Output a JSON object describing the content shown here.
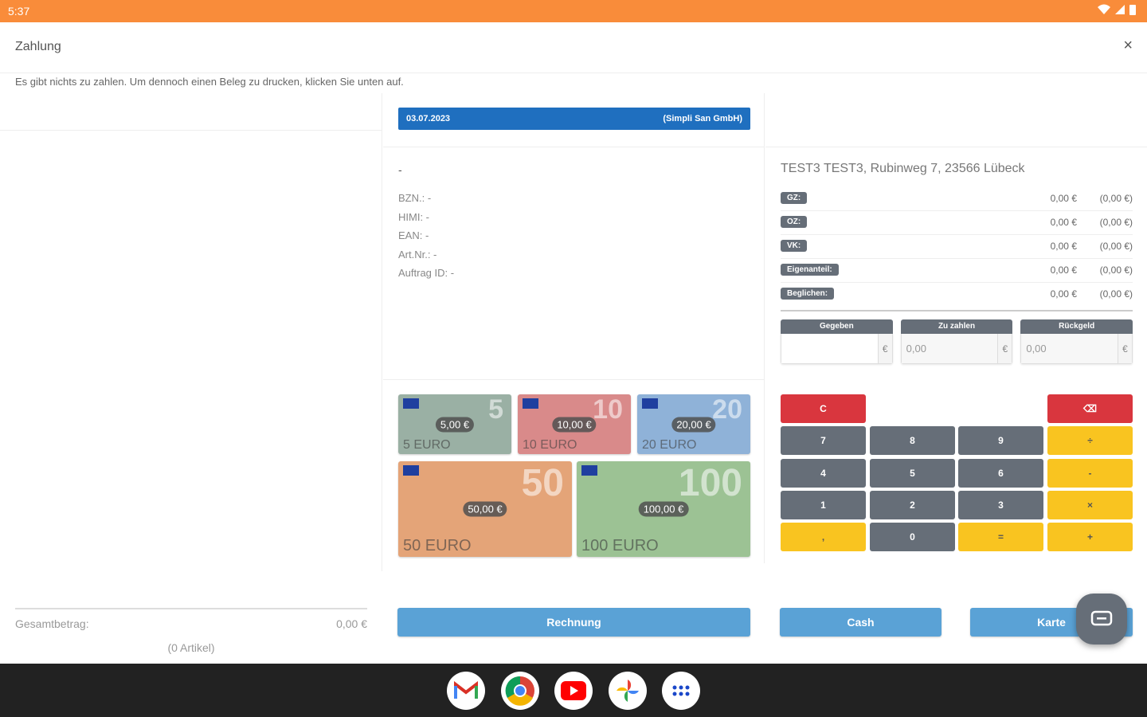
{
  "status_bar": {
    "time": "5:37"
  },
  "dialog": {
    "title": "Zahlung",
    "close_label": "×",
    "notice": "Es gibt nichts zu zahlen. Um dennoch einen Beleg zu drucken, klicken Sie unten auf."
  },
  "receipt": {
    "date": "03.07.2023",
    "company": "(Simpli San GmbH)",
    "dash": "-",
    "fields": [
      "BZN.: -",
      "HIMI: -",
      "EAN: -",
      "Art.Nr.: -",
      "Auftrag ID: -"
    ]
  },
  "banknotes": [
    {
      "amount": "5,00 €",
      "big": "5",
      "small": "5 EURO",
      "bg": "#9ab0a4"
    },
    {
      "amount": "10,00 €",
      "big": "10",
      "small": "10 EURO",
      "bg": "#d98a8a"
    },
    {
      "amount": "20,00 €",
      "big": "20",
      "small": "20 EURO",
      "bg": "#8fb2d8"
    },
    {
      "amount": "50,00 €",
      "big": "50",
      "small": "50 EURO",
      "bg": "#e4a478"
    },
    {
      "amount": "100,00 €",
      "big": "100",
      "small": "100 EURO",
      "bg": "#9cc294"
    }
  ],
  "customer": {
    "address": "TEST3 TEST3, Rubinweg 7, 23566 Lübeck"
  },
  "summary": [
    {
      "label": "GZ:",
      "value": "0,00 €",
      "paren": "(0,00 €)"
    },
    {
      "label": "OZ:",
      "value": "0,00 €",
      "paren": "(0,00 €)"
    },
    {
      "label": "VK:",
      "value": "0,00 €",
      "paren": "(0,00 €)"
    },
    {
      "label": "Eigenanteil:",
      "value": "0,00 €",
      "paren": "(0,00 €)"
    },
    {
      "label": "Beglichen:",
      "value": "0,00 €",
      "paren": "(0,00 €)"
    }
  ],
  "payment": {
    "given_label": "Gegeben",
    "given_value": "",
    "topay_label": "Zu zahlen",
    "topay_value": "0,00",
    "change_label": "Rückgeld",
    "change_value": "0,00",
    "currency": "€"
  },
  "keypad": {
    "clear": "C",
    "backspace": "⌫",
    "k7": "7",
    "k8": "8",
    "k9": "9",
    "div": "÷",
    "k4": "4",
    "k5": "5",
    "k6": "6",
    "minus": "-",
    "k1": "1",
    "k2": "2",
    "k3": "3",
    "mul": "×",
    "comma": ",",
    "k0": "0",
    "eq": "=",
    "plus": "+"
  },
  "buttons": {
    "invoice": "Rechnung",
    "cash": "Cash",
    "card": "Karte"
  },
  "totals": {
    "label": "Gesamtbetrag:",
    "value": "0,00 €",
    "count": "(0 Artikel)"
  },
  "colors": {
    "status_bar": "#f98c3a",
    "date_bar": "#1f6fbf",
    "action_button": "#5aa2d6",
    "key_red": "#d9363e",
    "key_gray": "#666e78",
    "key_yellow": "#f9c420"
  },
  "taskbar_apps": [
    "gmail-icon",
    "chrome-icon",
    "youtube-icon",
    "photos-icon",
    "app-drawer-icon"
  ]
}
